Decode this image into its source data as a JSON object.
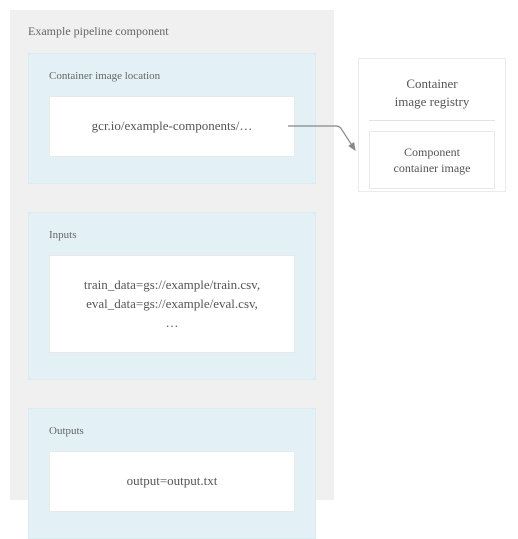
{
  "pipeline": {
    "title": "Example pipeline component",
    "sections": {
      "image_location": {
        "label": "Container image location",
        "value": "gcr.io/example-components/…"
      },
      "inputs": {
        "label": "Inputs",
        "value_line1": "train_data=gs://example/train.csv,",
        "value_line2": "eval_data=gs://example/eval.csv,",
        "value_line3": "…"
      },
      "outputs": {
        "label": "Outputs",
        "value": "output=output.txt"
      }
    }
  },
  "registry": {
    "title_line1": "Container",
    "title_line2": "image registry",
    "body_line1": "Component",
    "body_line2": "container image"
  }
}
